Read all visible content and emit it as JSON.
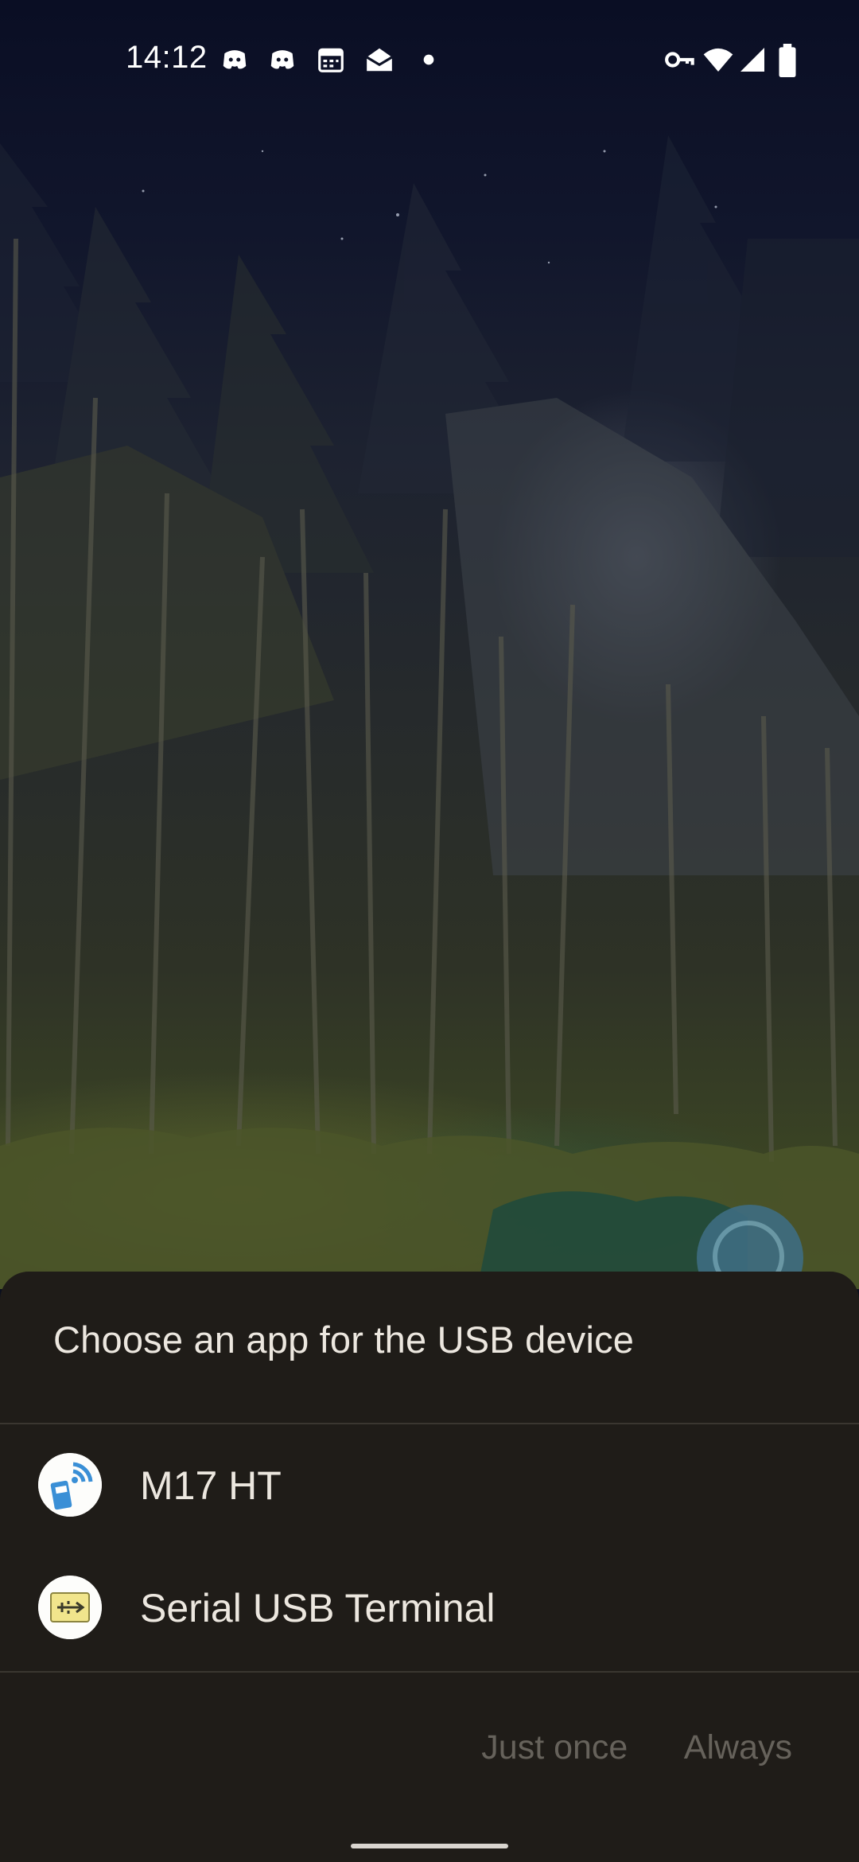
{
  "status_bar": {
    "time": "14:12",
    "notification_icons": [
      "discord-icon",
      "discord-icon",
      "calendar-icon",
      "mail-open-icon",
      "dot-icon"
    ],
    "system_icons": [
      "vpn-key-icon",
      "wifi-icon",
      "cell-signal-icon",
      "battery-icon"
    ]
  },
  "dialog": {
    "title": "Choose an app for the USB device",
    "apps": [
      {
        "label": "M17 HT",
        "icon": "m17-ht-app-icon"
      },
      {
        "label": "Serial USB Terminal",
        "icon": "serial-usb-terminal-app-icon"
      }
    ],
    "actions": {
      "just_once": "Just once",
      "always": "Always"
    }
  },
  "colors": {
    "sheet_background": "#1f1c18",
    "text_primary": "#ece7df",
    "text_disabled": "#66625b"
  }
}
